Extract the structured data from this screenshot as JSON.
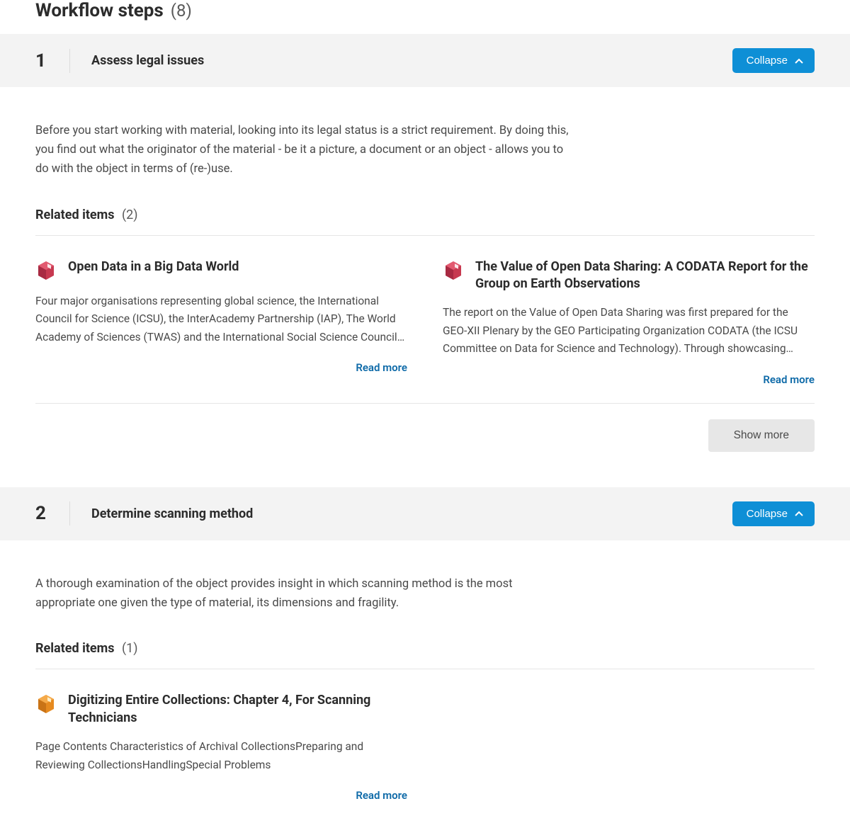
{
  "header": {
    "title": "Workflow steps",
    "count": "(8)"
  },
  "labels": {
    "collapse": "Collapse",
    "related_items": "Related items",
    "read_more": "Read more",
    "show_more": "Show more"
  },
  "steps": [
    {
      "number": "1",
      "title": "Assess legal issues",
      "description": "Before you start working with material, looking into its legal status is a strict requirement. By doing this, you find out what the originator of the material - be it a picture, a document or an object - allows you to do with the object in terms of (re-)use.",
      "related_count": "(2)",
      "items": [
        {
          "icon": "box-icon-red",
          "title": "Open Data in a Big Data World",
          "desc": "Four major organisations representing global science, the International Council for Science (ICSU), the InterAcademy Partnership (IAP), The World Academy of Sciences (TWAS) and the International Social Science Council…"
        },
        {
          "icon": "box-icon-red",
          "title": "The Value of Open Data Sharing: A CODATA Report for the Group on Earth Observations",
          "desc": "The report on the Value of Open Data Sharing was first prepared for the GEO-XII Plenary by the GEO Participating Organization CODATA (the ICSU Committee on Data for Science and Technology). Through showcasing…"
        }
      ],
      "show_more": true
    },
    {
      "number": "2",
      "title": "Determine scanning method",
      "description": "A thorough examination of the object provides insight in which scanning method is the most appropriate one given the type of material, its dimensions and fragility.",
      "related_count": "(1)",
      "items": [
        {
          "icon": "box-icon-orange",
          "title": "Digitizing Entire Collections: Chapter 4, For Scanning Technicians",
          "desc": "Page Contents Characteristics of Archival CollectionsPreparing and Reviewing CollectionsHandlingSpecial Problems"
        }
      ],
      "show_more": false
    }
  ]
}
